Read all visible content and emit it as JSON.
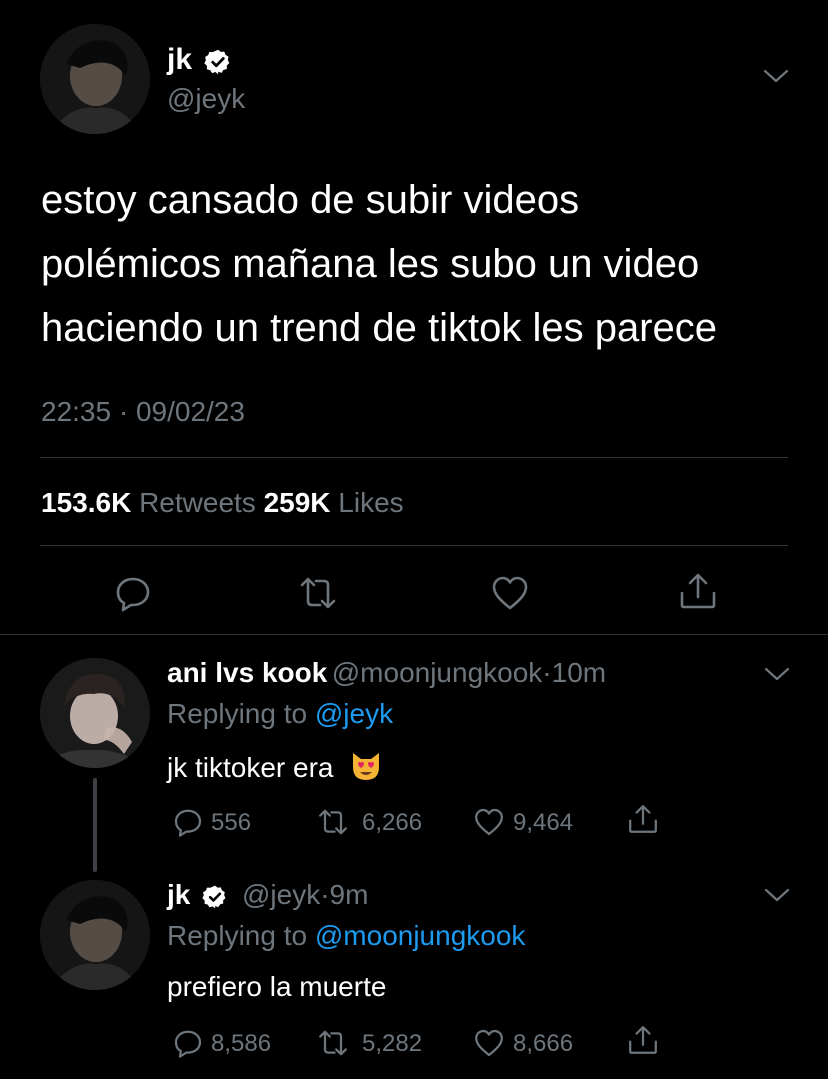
{
  "main_tweet": {
    "name": "jk",
    "handle": "@jeyk",
    "text_lines": [
      "estoy cansado de subir videos",
      "polémicos mañana les subo un video",
      "haciendo un trend de tiktok les parece"
    ],
    "timestamp": "22:35 · 09/02/23",
    "retweets_count": "153.6K",
    "retweets_label": "Retweets",
    "likes_count": "259K",
    "likes_label": "Likes",
    "icons": [
      "reply-icon",
      "retweet-icon",
      "like-icon",
      "share-icon",
      "verified-icon",
      "chevron-down-icon"
    ]
  },
  "replies": [
    {
      "name": "ani lvs kook",
      "handle": "@moonjungkook",
      "sep": "·",
      "time": "10m",
      "replying_prefix": "Replying to ",
      "replying_to": "@jeyk",
      "text": "jk tiktoker era",
      "emoji": "heart-eyes-cat-emoji",
      "reply_count": "556",
      "retweet_count": "6,266",
      "like_count": "9,464"
    },
    {
      "name": "jk",
      "handle": "@jeyk",
      "sep": "·",
      "time": "9m",
      "replying_prefix": "Replying to ",
      "replying_to": "@moonjungkook",
      "text": "prefiero la muerte",
      "reply_count": "8,586",
      "retweet_count": "5,282",
      "like_count": "8,666"
    }
  ],
  "colors": {
    "background": "#000000",
    "text": "#ffffff",
    "muted": "#6e767d",
    "link": "#1d9bf0",
    "divider": "#2f3336"
  }
}
